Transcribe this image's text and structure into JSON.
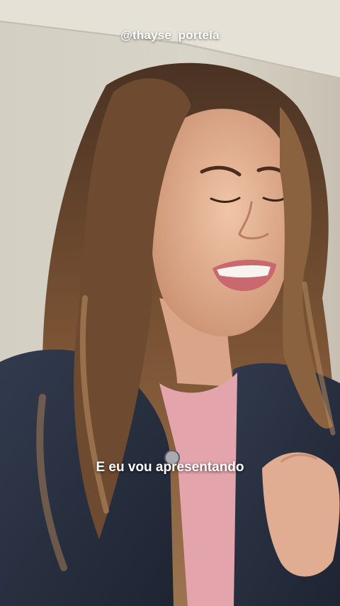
{
  "watermark": {
    "handle": "@thayse_portela"
  },
  "subtitle": {
    "text": "E eu vou apresentando"
  },
  "colors": {
    "wall": "#d6d1c5",
    "ceiling": "#e6e2d8",
    "hair": "#5a3a26",
    "hair_highlight": "#a97c55",
    "skin": "#e6b79a",
    "lips": "#c9686f",
    "tshirt": "#e7a9ae",
    "jacket": "#2b3344"
  }
}
